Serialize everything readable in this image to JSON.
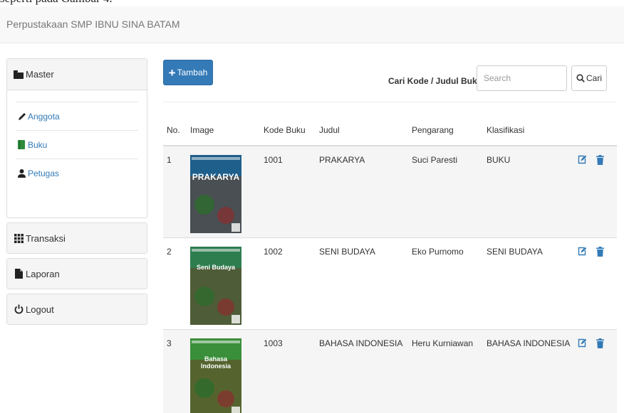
{
  "doc_snippet": "seperti pada Gambar 4.",
  "navbar": {
    "brand": "Perpustakaan SMP IBNU SINA BATAM"
  },
  "sidebar": {
    "master": {
      "label": "Master",
      "icon": "folder-icon",
      "items": [
        {
          "label": "Anggota",
          "icon": "pencil-icon"
        },
        {
          "label": "Buku",
          "icon": "book-icon"
        },
        {
          "label": "Petugas",
          "icon": "user-icon"
        }
      ]
    },
    "transaksi": {
      "label": "Transaksi",
      "icon": "grid-icon"
    },
    "laporan": {
      "label": "Laporan",
      "icon": "file-icon"
    },
    "logout": {
      "label": "Logout",
      "icon": "power-icon"
    }
  },
  "toolbar": {
    "add_label": "Tambah",
    "search_label": "Cari Kode / Judul Buku",
    "search_placeholder": "Search",
    "search_button": "Cari"
  },
  "table": {
    "headers": [
      "No.",
      "Image",
      "Kode Buku",
      "Judul",
      "Pengarang",
      "Klasifikasi"
    ],
    "rows": [
      {
        "no": "1",
        "kode": "1001",
        "judul": "PRAKARYA",
        "pengarang": "Suci Paresti",
        "klasifikasi": "BUKU",
        "cover_title": "PRAKARYA",
        "cover_color": "#1f5f8b"
      },
      {
        "no": "2",
        "kode": "1002",
        "judul": "SENI BUDAYA",
        "pengarang": "Eko Purnomo",
        "klasifikasi": "SENI BUDAYA",
        "cover_title": "Seni Budaya",
        "cover_color": "#2e7d4f"
      },
      {
        "no": "3",
        "kode": "1003",
        "judul": "BAHASA INDONESIA",
        "pengarang": "Heru Kurniawan",
        "klasifikasi": "BAHASA INDONESIA",
        "cover_title": "Bahasa Indonesia",
        "cover_color": "#3a8f3a"
      }
    ]
  },
  "colors": {
    "primary": "#337ab7",
    "navbar_bg": "#f8f8f8",
    "row_stripe": "#f5f5f5"
  }
}
